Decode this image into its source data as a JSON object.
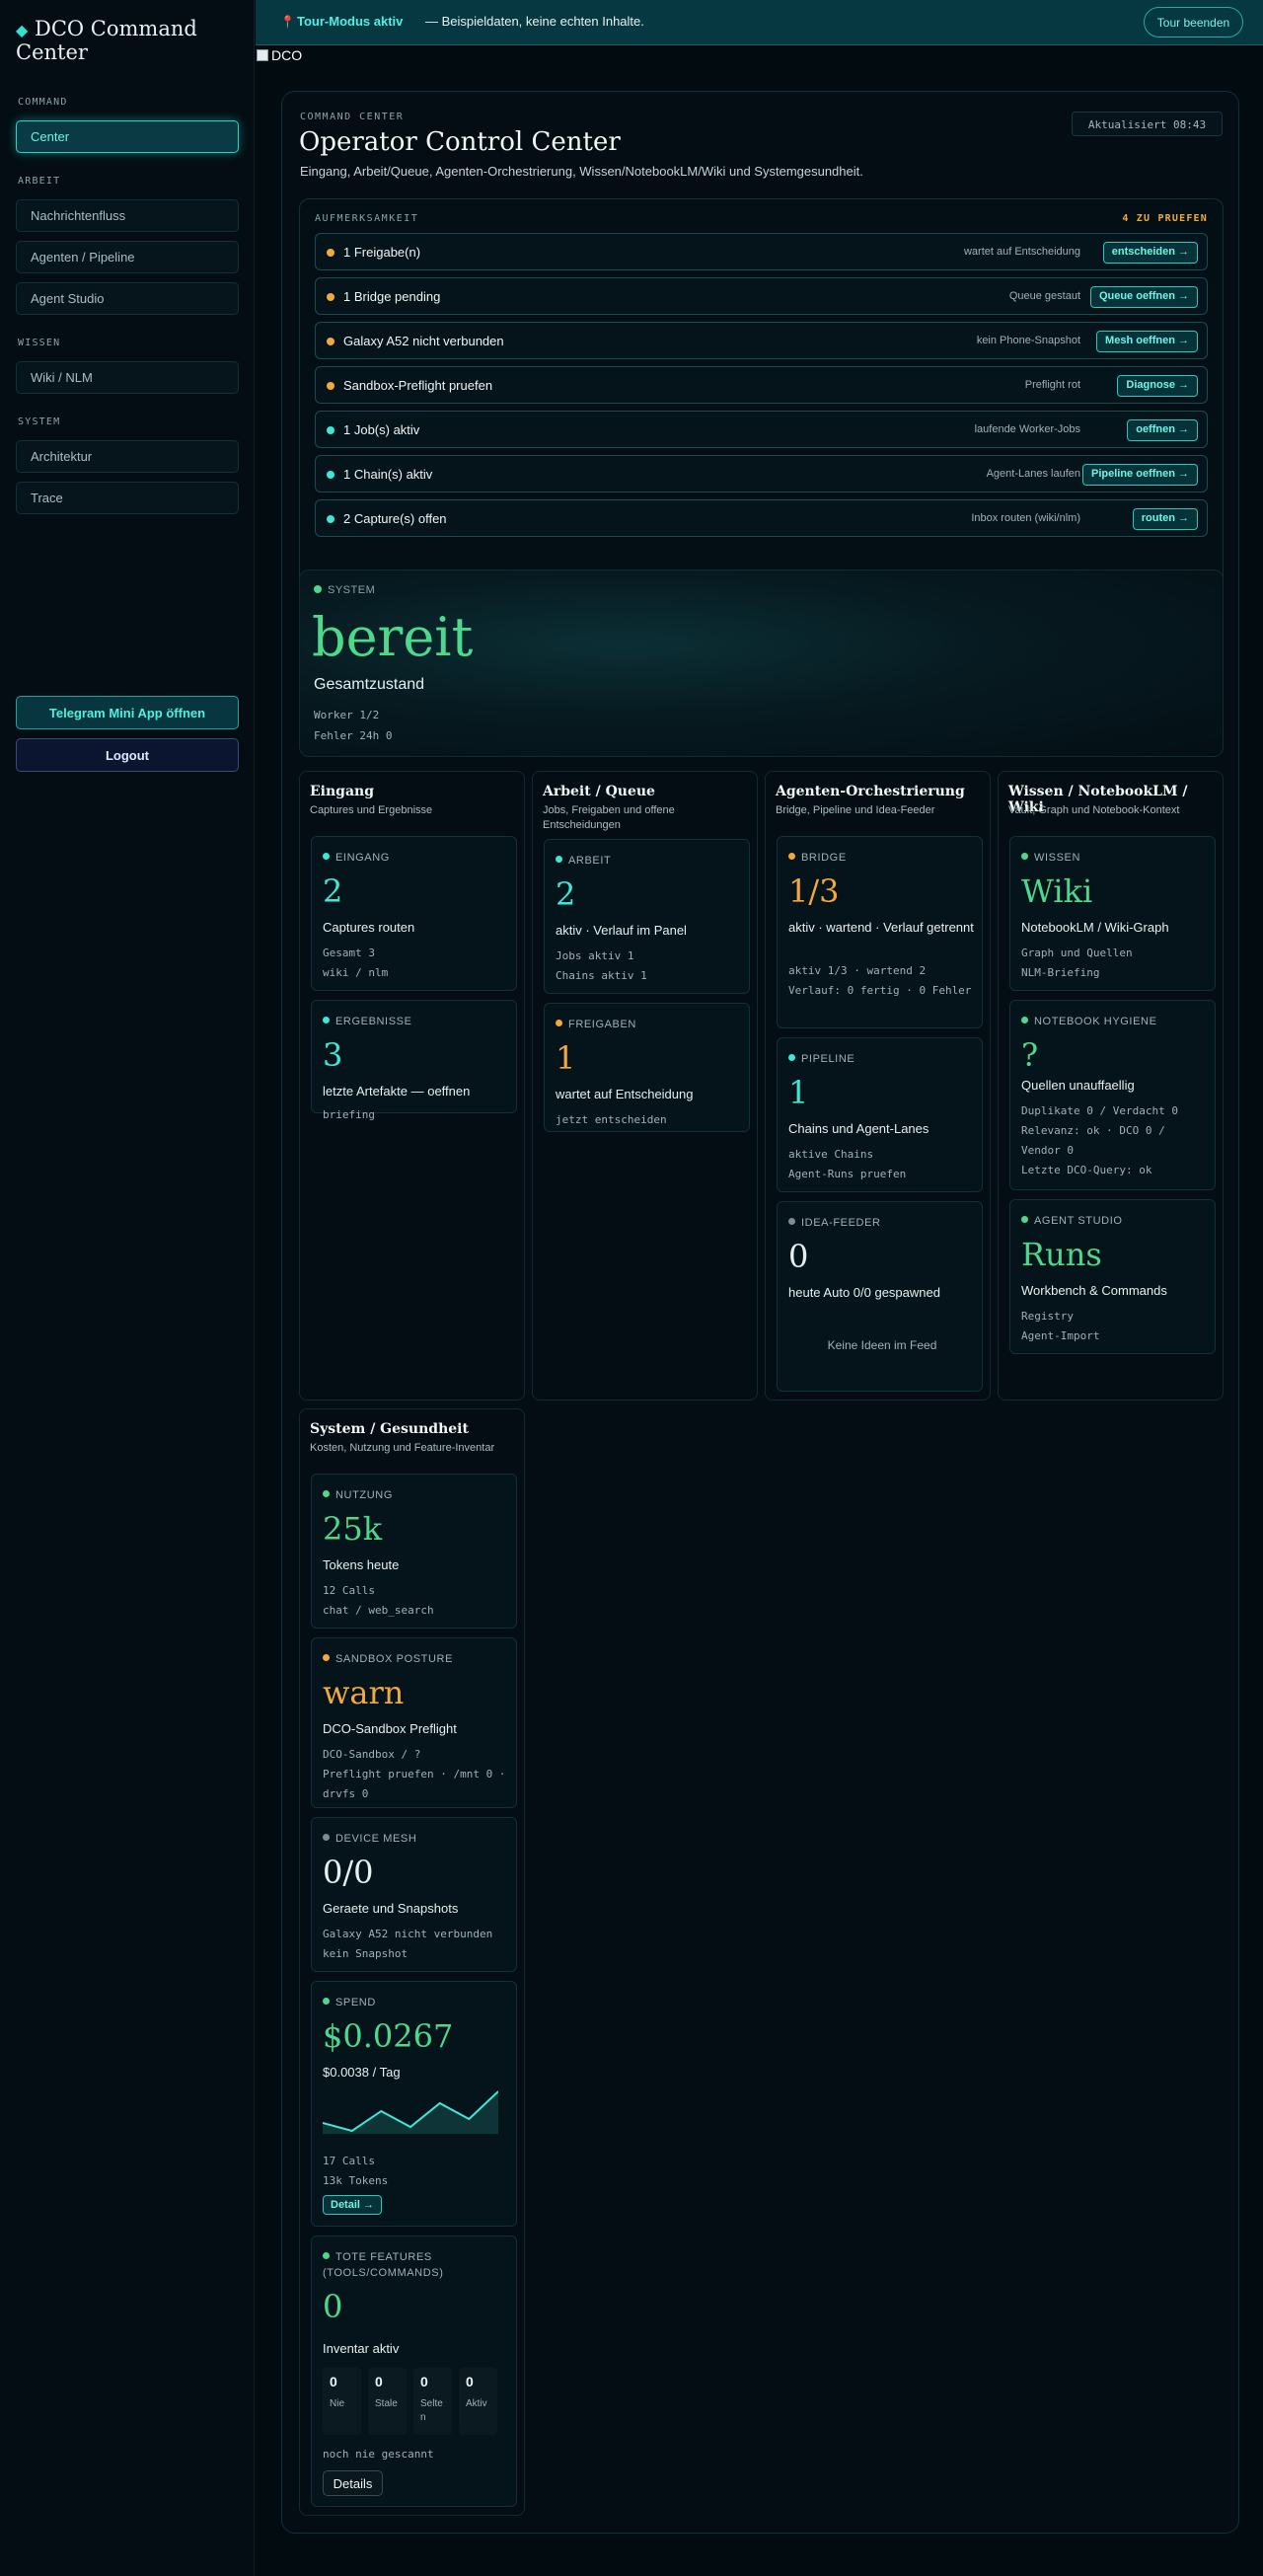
{
  "sidebar": {
    "brand": "DCO Command Center",
    "groups": [
      {
        "title": "COMMAND",
        "items": [
          "Center"
        ]
      },
      {
        "title": "ARBEIT",
        "items": [
          "Nachrichtenfluss",
          "Agenten / Pipeline",
          "Agent Studio"
        ]
      },
      {
        "title": "WISSEN",
        "items": [
          "Wiki / NLM"
        ]
      },
      {
        "title": "SYSTEM",
        "items": [
          "Architektur",
          "Trace"
        ]
      }
    ],
    "telegram_button": "Telegram Mini App öffnen",
    "logout_button": "Logout"
  },
  "banner": {
    "title": "Tour-Modus aktiv",
    "text": "— Beispieldaten, keine echten Inhalte.",
    "end_button": "Tour beenden"
  },
  "dco_checkbox_label": "DCO",
  "header": {
    "label": "COMMAND CENTER",
    "title": "Operator Control Center",
    "subtitle": "Eingang, Arbeit/Queue, Agenten-Orchestrierung, Wissen/NotebookLM/Wiki und Systemgesundheit.",
    "updated": "Aktualisiert 08:43"
  },
  "attention": {
    "title": "AUFMERKSAMKEIT",
    "count": "4 ZU PRUEFEN",
    "rows": [
      {
        "color": "amber",
        "label": "1 Freigabe(n)",
        "hint": "wartet auf Entscheidung",
        "action": "entscheiden →"
      },
      {
        "color": "amber",
        "label": "1 Bridge pending",
        "hint": "Queue gestaut",
        "action": "Queue oeffnen →"
      },
      {
        "color": "amber",
        "label": "Galaxy A52 nicht verbunden",
        "hint": "kein Phone-Snapshot",
        "action": "Mesh oeffnen →"
      },
      {
        "color": "amber",
        "label": "Sandbox-Preflight pruefen",
        "hint": "Preflight rot",
        "action": "Diagnose →"
      },
      {
        "color": "cyan",
        "label": "1 Job(s) aktiv",
        "hint": "laufende Worker-Jobs",
        "action": "oeffnen →"
      },
      {
        "color": "cyan",
        "label": "1 Chain(s) aktiv",
        "hint": "Agent-Lanes laufen",
        "action": "Pipeline oeffnen →"
      },
      {
        "color": "cyan",
        "label": "2 Capture(s) offen",
        "hint": "Inbox routen (wiki/nlm)",
        "action": "routen →"
      }
    ]
  },
  "system": {
    "label": "SYSTEM",
    "status": "bereit",
    "subtitle": "Gesamtzustand",
    "workers": "Worker 1/2",
    "errors": "Fehler 24h 0"
  },
  "columns": {
    "eingang": {
      "title": "Eingang",
      "subtitle": "Captures und Ergebnisse",
      "cards": [
        {
          "label": "EINGANG",
          "value": "2",
          "desc": "Captures routen",
          "meta": [
            "Gesamt 3",
            "wiki / nlm"
          ]
        },
        {
          "label": "ERGEBNISSE",
          "value": "3",
          "desc": "letzte Artefakte — oeffnen",
          "meta": [
            "briefing"
          ]
        }
      ]
    },
    "arbeit": {
      "title": "Arbeit / Queue",
      "subtitle": "Jobs, Freigaben und offene Entscheidungen",
      "cards": [
        {
          "label": "ARBEIT",
          "value": "2",
          "desc": "aktiv · Verlauf im Panel",
          "meta": [
            "Jobs aktiv 1",
            "Chains aktiv 1"
          ]
        },
        {
          "label": "FREIGABEN",
          "value": "1",
          "desc": "wartet auf Entscheidung",
          "meta": [
            "jetzt entscheiden"
          ]
        }
      ]
    },
    "agenten": {
      "title": "Agenten-Orchestrierung",
      "subtitle": "Bridge, Pipeline und Idea-Feeder",
      "cards": [
        {
          "label": "BRIDGE",
          "value": "1/3",
          "desc": "aktiv · wartend · Verlauf getrennt",
          "meta": [
            "aktiv 1/3 · wartend 2",
            "Verlauf: 0 fertig · 0 Fehler"
          ]
        },
        {
          "label": "PIPELINE",
          "value": "1",
          "desc": "Chains und Agent-Lanes",
          "meta": [
            "aktive Chains",
            "Agent-Runs pruefen"
          ]
        },
        {
          "label": "IDEA-FEEDER",
          "value": "0",
          "desc": "heute Auto 0/0 gespawned",
          "empty": "Keine Ideen im Feed"
        }
      ]
    },
    "wissen": {
      "title": "Wissen / NotebookLM / Wiki",
      "subtitle": "Vault, Graph und Notebook-Kontext",
      "cards": [
        {
          "label": "WISSEN",
          "value": "Wiki",
          "desc": "NotebookLM / Wiki-Graph",
          "meta": [
            "Graph und Quellen",
            "NLM-Briefing"
          ]
        },
        {
          "label": "NOTEBOOK HYGIENE",
          "value": "?",
          "desc": "Quellen unauffaellig",
          "meta": [
            "Duplikate 0 / Verdacht 0",
            "Relevanz: ok · DCO 0 / Vendor 0",
            "Letzte DCO-Query: ok"
          ]
        },
        {
          "label": "AGENT STUDIO",
          "value": "Runs",
          "desc": "Workbench & Commands",
          "meta": [
            "Registry",
            "Agent-Import"
          ]
        }
      ]
    },
    "system_health": {
      "title": "System / Gesundheit",
      "subtitle": "Kosten, Nutzung und Feature-Inventar",
      "cards": [
        {
          "label": "NUTZUNG",
          "value": "25k",
          "desc": "Tokens heute",
          "meta": [
            "12 Calls",
            "chat / web_search"
          ]
        },
        {
          "label": "SANDBOX POSTURE",
          "value": "warn",
          "desc": "DCO-Sandbox Preflight",
          "meta": [
            "DCO-Sandbox / ?",
            "Preflight pruefen · /mnt 0 · drvfs 0"
          ]
        },
        {
          "label": "DEVICE MESH",
          "value": "0/0",
          "desc": "Geraete und Snapshots",
          "meta": [
            "Galaxy A52 nicht verbunden",
            "kein Snapshot"
          ]
        },
        {
          "label": "SPEND",
          "value": "$0.0267",
          "desc": "$0.0038 / Tag",
          "meta": [
            "17 Calls",
            "13k Tokens"
          ],
          "button": "Detail →"
        },
        {
          "label": "TOTE FEATURES (TOOLS/COMMANDS)",
          "value": "0",
          "desc": "Inventar aktiv",
          "meta": [
            "noch nie gescannt"
          ],
          "button": "Details",
          "tiles": [
            {
              "n": "0",
              "t": "Nie"
            },
            {
              "n": "0",
              "t": "Stale"
            },
            {
              "n": "0",
              "t": "Selten"
            },
            {
              "n": "0",
              "t": "Aktiv"
            }
          ]
        }
      ]
    }
  },
  "spend_chart": {
    "values": [
      3,
      1,
      6,
      2,
      8,
      4,
      11
    ],
    "color": "#3ce8d6"
  },
  "colors": {
    "accent": "#3ce8d6",
    "warn": "#f2a93b",
    "ok": "#4dd88c",
    "bg": "#020b10"
  }
}
